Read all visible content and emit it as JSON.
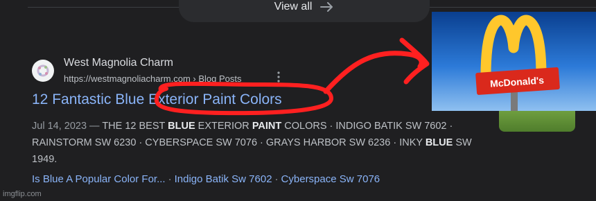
{
  "view_all": {
    "label": "View all",
    "icon": "arrow-right-icon"
  },
  "result": {
    "site_name": "West Magnolia Charm",
    "url": "https://westmagnoliacharm.com › Blog Posts",
    "title": "12 Fantastic Blue Exterior Paint Colors",
    "date": "Jul 14, 2023 —",
    "snippet_parts": [
      {
        "text": " THE 12 BEST ",
        "bold": false
      },
      {
        "text": "BLUE",
        "bold": true
      },
      {
        "text": " EXTERIOR ",
        "bold": false
      },
      {
        "text": "PAINT",
        "bold": true
      },
      {
        "text": " COLORS · INDIGO BATIK SW 7602 · RAINSTORM SW 6230 · CYBERSPACE SW 7076 · GRAYS HARBOR SW 6236 · INKY ",
        "bold": false
      },
      {
        "text": "BLUE",
        "bold": true
      },
      {
        "text": " SW 1949.",
        "bold": false
      }
    ],
    "sitelinks": [
      "Is Blue A Popular Color For...",
      "Indigo Batik Sw 7602",
      "Cyberspace Sw 7076"
    ]
  },
  "overlay": {
    "logo_text": "McDonald's",
    "arch_color": "#ffc72c",
    "sign_color": "#da291c",
    "annotation_color": "#ff2020"
  },
  "watermark": "imgflip.com"
}
